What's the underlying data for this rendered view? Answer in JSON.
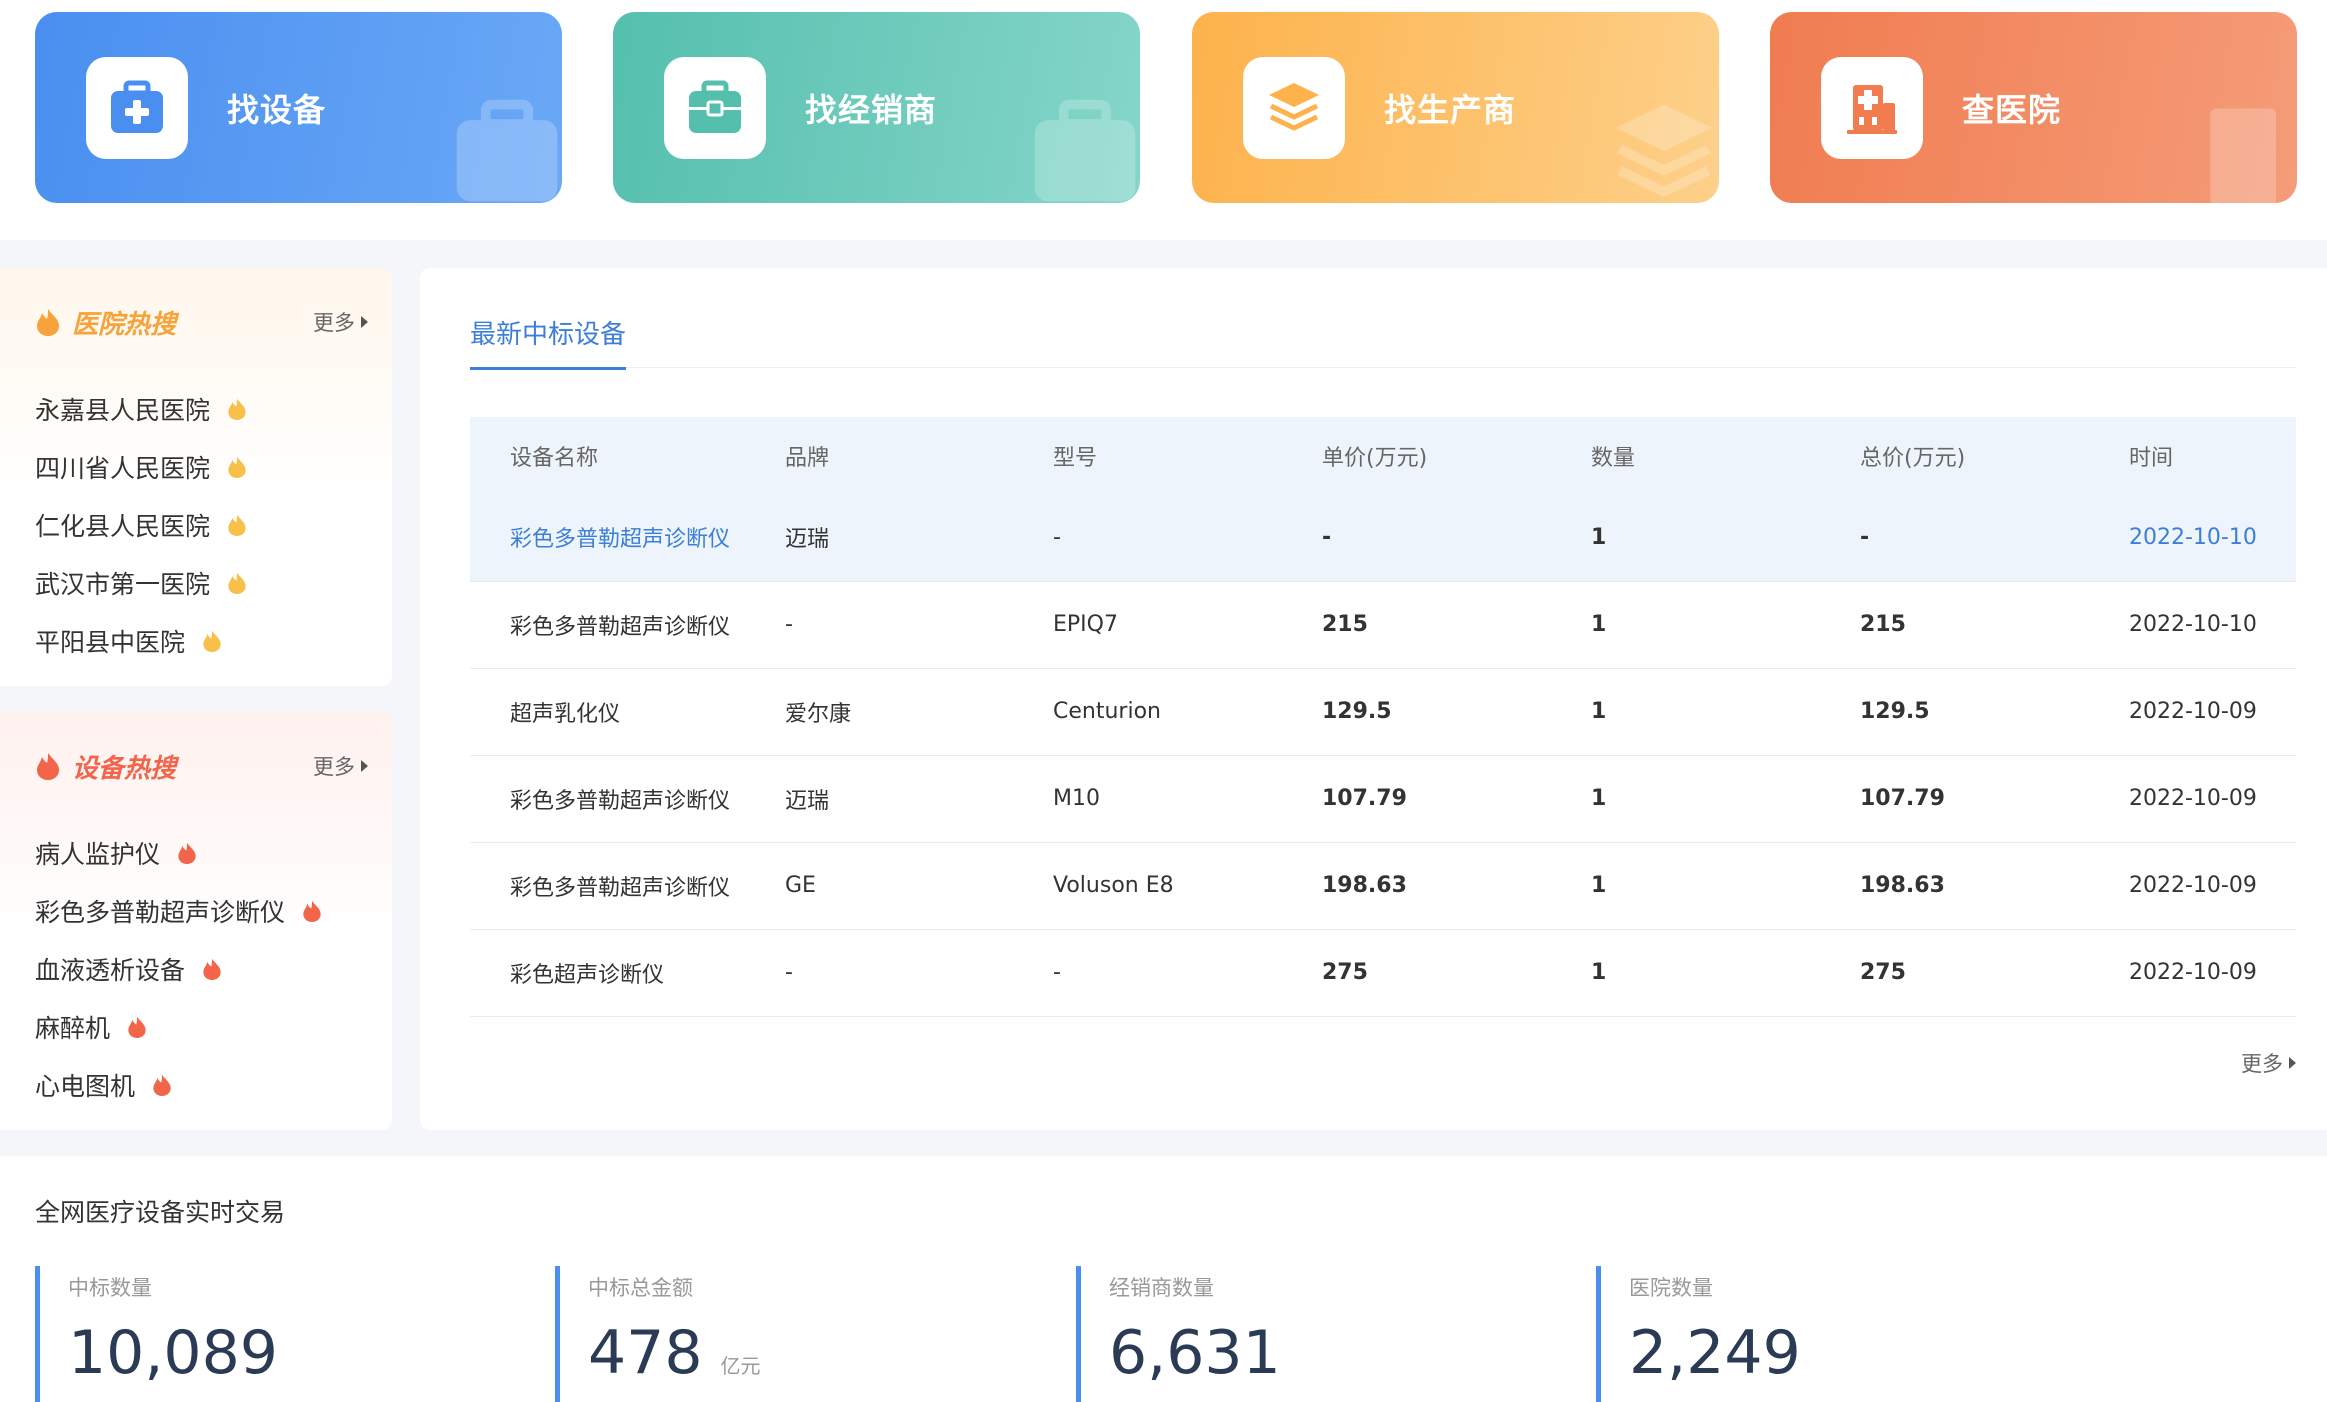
{
  "cards": [
    {
      "label": "找设备"
    },
    {
      "label": "找经销商"
    },
    {
      "label": "找生产商"
    },
    {
      "label": "查医院"
    }
  ],
  "hospital_hot": {
    "title": "医院热搜",
    "more": "更多",
    "items": [
      "永嘉县人民医院",
      "四川省人民医院",
      "仁化县人民医院",
      "武汉市第一医院",
      "平阳县中医院"
    ]
  },
  "equipment_hot": {
    "title": "设备热搜",
    "more": "更多",
    "items": [
      "病人监护仪",
      "彩色多普勒超声诊断仪",
      "血液透析设备",
      "麻醉机",
      "心电图机"
    ]
  },
  "main": {
    "tab": "最新中标设备",
    "more": "更多",
    "columns": [
      "设备名称",
      "品牌",
      "型号",
      "单价(万元)",
      "数量",
      "总价(万元)",
      "时间"
    ],
    "rows": [
      [
        "彩色多普勒超声诊断仪",
        "迈瑞",
        "-",
        "-",
        "1",
        "-",
        "2022-10-10"
      ],
      [
        "彩色多普勒超声诊断仪",
        "-",
        "EPIQ7",
        "215",
        "1",
        "215",
        "2022-10-10"
      ],
      [
        "超声乳化仪",
        "爱尔康",
        "Centurion",
        "129.5",
        "1",
        "129.5",
        "2022-10-09"
      ],
      [
        "彩色多普勒超声诊断仪",
        "迈瑞",
        "M10",
        "107.79",
        "1",
        "107.79",
        "2022-10-09"
      ],
      [
        "彩色多普勒超声诊断仪",
        "GE",
        "Voluson E8",
        "198.63",
        "1",
        "198.63",
        "2022-10-09"
      ],
      [
        "彩色超声诊断仪",
        "-",
        "-",
        "275",
        "1",
        "275",
        "2022-10-09"
      ]
    ]
  },
  "stats": {
    "title": "全网医疗设备实时交易",
    "items": [
      {
        "label": "中标数量",
        "value": "10,089",
        "unit": ""
      },
      {
        "label": "中标总金额",
        "value": "478",
        "unit": "亿元"
      },
      {
        "label": "经销商数量",
        "value": "6,631",
        "unit": ""
      },
      {
        "label": "医院数量",
        "value": "2,249",
        "unit": ""
      }
    ]
  },
  "colors": {
    "accent": "#3d7fd8",
    "card_blue": "#4a8ff0",
    "card_teal": "#55bfae",
    "card_yellow": "#fdb24b",
    "card_orange": "#f07c50",
    "flame_yellow": "#f7c04a",
    "flame_red": "#f2654a"
  }
}
